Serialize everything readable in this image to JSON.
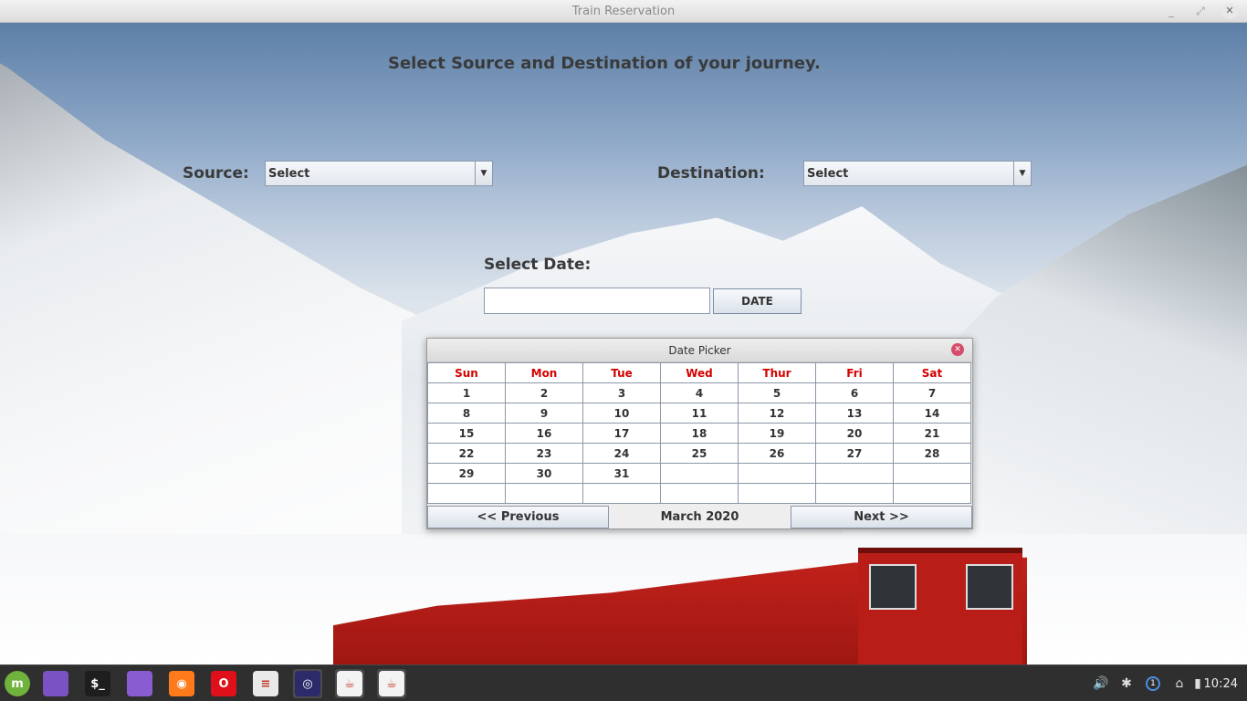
{
  "window": {
    "title": "Train Reservation"
  },
  "form": {
    "heading": "Select Source and Destination of your journey.",
    "source_label": "Source:",
    "source_value": "Select",
    "destination_label": "Destination:",
    "destination_value": "Select",
    "date_label": "Select Date:",
    "date_value": "",
    "date_button": "DATE"
  },
  "date_picker": {
    "title": "Date Picker",
    "weekdays": [
      "Sun",
      "Mon",
      "Tue",
      "Wed",
      "Thur",
      "Fri",
      "Sat"
    ],
    "weeks": [
      [
        "1",
        "2",
        "3",
        "4",
        "5",
        "6",
        "7"
      ],
      [
        "8",
        "9",
        "10",
        "11",
        "12",
        "13",
        "14"
      ],
      [
        "15",
        "16",
        "17",
        "18",
        "19",
        "20",
        "21"
      ],
      [
        "22",
        "23",
        "24",
        "25",
        "26",
        "27",
        "28"
      ],
      [
        "29",
        "30",
        "31",
        "",
        "",
        "",
        ""
      ],
      [
        "",
        "",
        "",
        "",
        "",
        "",
        ""
      ]
    ],
    "prev_label": "<< Previous",
    "month_label": "March 2020",
    "next_label": "Next >>",
    "weekday_color": "#d40000"
  },
  "taskbar": {
    "apps": [
      {
        "name": "mint-menu-icon",
        "color": "#6fb23c",
        "glyph": "m"
      },
      {
        "name": "desktop-icon",
        "color": "#7b52c4",
        "glyph": ""
      },
      {
        "name": "terminal-icon",
        "color": "#1e1e1e",
        "glyph": "$_"
      },
      {
        "name": "files-icon",
        "color": "#8a5cd1",
        "glyph": ""
      },
      {
        "name": "firefox-icon",
        "color": "#ff7a1a",
        "glyph": "◉"
      },
      {
        "name": "opera-icon",
        "color": "#e0101a",
        "glyph": "O"
      },
      {
        "name": "text-editor-icon",
        "color": "#e9e9e9",
        "glyph": "≡"
      },
      {
        "name": "eclipse-icon",
        "color": "#2d2a6b",
        "glyph": "◎"
      },
      {
        "name": "java-icon",
        "color": "#f3f3f3",
        "glyph": "☕"
      },
      {
        "name": "java-icon",
        "color": "#f3f3f3",
        "glyph": "☕"
      }
    ],
    "tray": {
      "volume": "🔊",
      "bluetooth": "✱",
      "update_count": "1",
      "network": "⌂",
      "battery": "▮"
    },
    "clock": "10:24"
  }
}
